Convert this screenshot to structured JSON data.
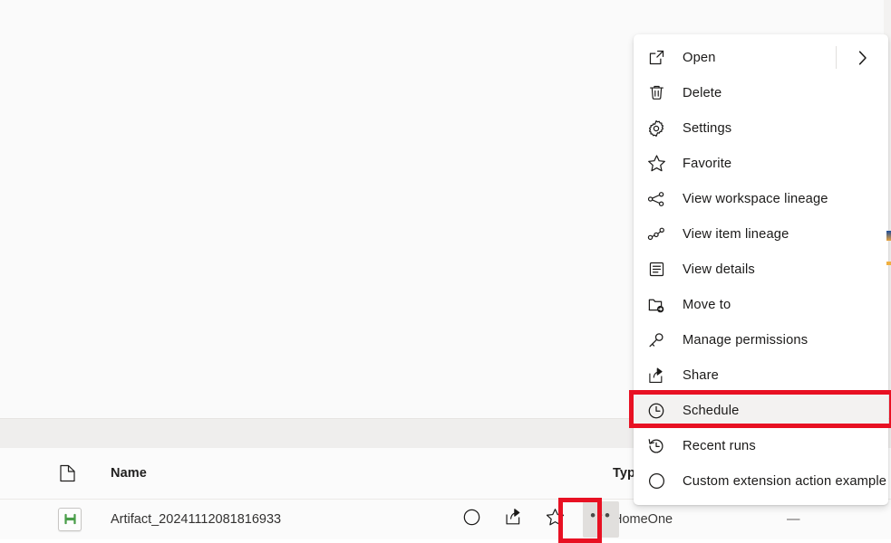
{
  "context_menu": {
    "items": [
      {
        "label": "Open",
        "icon": "open-external-icon",
        "has_submenu": true
      },
      {
        "label": "Delete",
        "icon": "trash-icon",
        "has_submenu": false
      },
      {
        "label": "Settings",
        "icon": "gear-icon",
        "has_submenu": false
      },
      {
        "label": "Favorite",
        "icon": "star-icon",
        "has_submenu": false
      },
      {
        "label": "View workspace lineage",
        "icon": "workspace-lineage-icon",
        "has_submenu": false
      },
      {
        "label": "View item lineage",
        "icon": "item-lineage-icon",
        "has_submenu": false
      },
      {
        "label": "View details",
        "icon": "details-list-icon",
        "has_submenu": false
      },
      {
        "label": "Move to",
        "icon": "folder-move-icon",
        "has_submenu": false
      },
      {
        "label": "Manage permissions",
        "icon": "key-icon",
        "has_submenu": false
      },
      {
        "label": "Share",
        "icon": "share-icon",
        "has_submenu": false
      },
      {
        "label": "Schedule",
        "icon": "clock-icon",
        "has_submenu": false,
        "highlighted": true
      },
      {
        "label": "Recent runs",
        "icon": "history-icon",
        "has_submenu": false
      },
      {
        "label": "Custom extension action example",
        "icon": "circle-icon",
        "has_submenu": false
      }
    ],
    "submenu_chevron": "›"
  },
  "table": {
    "headers": {
      "icon_column": "file-type-icon",
      "name": "Name",
      "type": "Typ"
    },
    "rows": [
      {
        "badge_icon": "artifact-green-icon",
        "name": "Artifact_20241112081816933",
        "type": "HomeOne",
        "extra": "—",
        "actions": [
          {
            "icon": "circle-icon"
          },
          {
            "icon": "share-icon"
          },
          {
            "icon": "star-icon"
          },
          {
            "icon": "more-options-icon",
            "label": "•••",
            "active": true
          }
        ]
      }
    ]
  },
  "annotations": {
    "accent_color": "#e81123",
    "highlight_background": "#f3f2f1",
    "more_button_background": "#e1dfdd"
  }
}
